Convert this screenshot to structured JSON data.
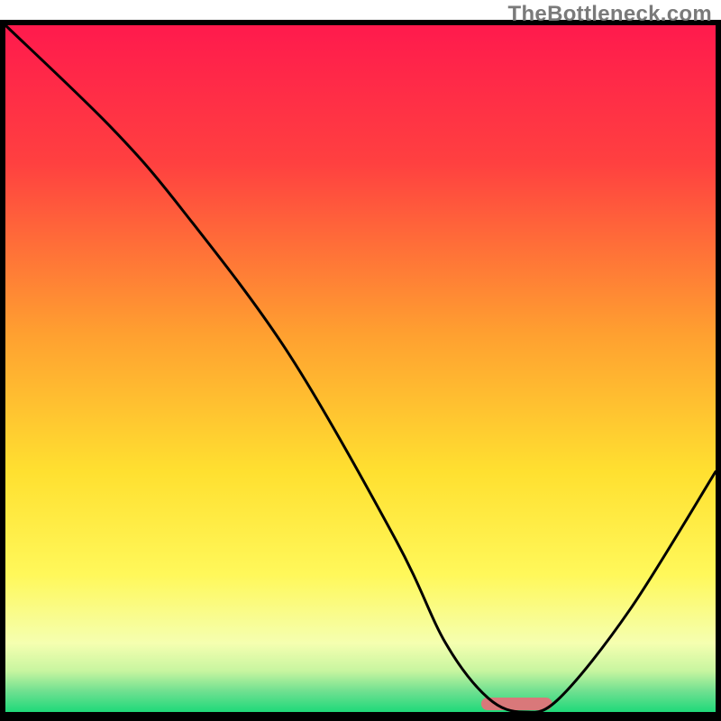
{
  "watermark": "TheBottleneck.com",
  "chart_data": {
    "type": "line",
    "title": "",
    "xlabel": "",
    "ylabel": "",
    "xlim": [
      0,
      100
    ],
    "ylim": [
      0,
      100
    ],
    "grid": false,
    "legend": false,
    "series": [
      {
        "name": "bottleneck-curve",
        "x": [
          0,
          15,
          25,
          40,
          55,
          62,
          68,
          73,
          78,
          88,
          100
        ],
        "values": [
          100,
          85,
          73,
          52,
          25,
          10,
          2,
          0,
          2,
          15,
          35
        ]
      }
    ],
    "marker": {
      "name": "optimal-marker",
      "x_start": 67,
      "x_end": 77,
      "color": "#d9787a"
    },
    "background_gradient": {
      "type": "vertical",
      "stops": [
        {
          "offset": 0.0,
          "color": "#ff1a4d"
        },
        {
          "offset": 0.2,
          "color": "#ff4040"
        },
        {
          "offset": 0.45,
          "color": "#ffa030"
        },
        {
          "offset": 0.65,
          "color": "#ffe030"
        },
        {
          "offset": 0.8,
          "color": "#fff85a"
        },
        {
          "offset": 0.9,
          "color": "#f5ffb0"
        },
        {
          "offset": 0.94,
          "color": "#c8f5a0"
        },
        {
          "offset": 0.97,
          "color": "#6fe090"
        },
        {
          "offset": 1.0,
          "color": "#1fd97a"
        }
      ]
    },
    "border_color": "#000000",
    "border_width_top_sides": 6,
    "border_width_bottom": 10
  }
}
